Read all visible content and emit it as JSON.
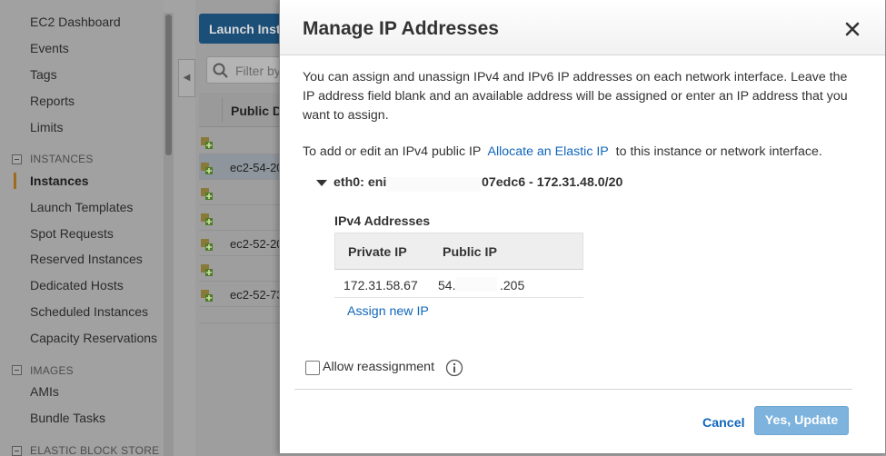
{
  "sidebar": {
    "items": [
      {
        "label": "EC2 Dashboard"
      },
      {
        "label": "Events"
      },
      {
        "label": "Tags"
      },
      {
        "label": "Reports"
      },
      {
        "label": "Limits"
      }
    ],
    "instances_section": "INSTANCES",
    "instances_items": [
      {
        "label": "Instances",
        "active": true
      },
      {
        "label": "Launch Templates"
      },
      {
        "label": "Spot Requests"
      },
      {
        "label": "Reserved Instances"
      },
      {
        "label": "Dedicated Hosts"
      },
      {
        "label": "Scheduled Instances"
      },
      {
        "label": "Capacity Reservations"
      }
    ],
    "images_section": "IMAGES",
    "images_items": [
      {
        "label": "AMIs"
      },
      {
        "label": "Bundle Tasks"
      }
    ],
    "ebs_section": "ELASTIC BLOCK STORE"
  },
  "content": {
    "launch_label": "Launch Insta",
    "filter_placeholder": "Filter by",
    "column_header": "Public D",
    "rows": [
      "",
      "ec2-54-20",
      "",
      "",
      "ec2-52-20",
      "",
      "ec2-52-73"
    ]
  },
  "modal": {
    "title": "Manage IP Addresses",
    "intro": "You can assign and unassign IPv4 and IPv6 IP addresses on each network interface. Leave the IP address field blank and an available address will be assigned or enter an IP address that you want to assign.",
    "add_prefix": "To add or edit an IPv4 public IP",
    "allocate_link": "Allocate an Elastic IP",
    "add_suffix": "to this instance or network interface.",
    "eth_label": "eth0: eni",
    "eth_suffix": "07edc6 - 172.31.48.0/20",
    "ipv4_heading": "IPv4 Addresses",
    "table": {
      "headers": [
        "Private IP",
        "Public IP"
      ],
      "private_ip": "172.31.58.67",
      "public_ip_prefix": "54.",
      "public_ip_suffix": ".205"
    },
    "assign_link": "Assign new IP",
    "allow_reassignment": "Allow reassignment",
    "cancel_label": "Cancel",
    "update_label": "Yes, Update"
  },
  "colors": {
    "accent": "#1166bb",
    "primary_button": "#7db3dd",
    "overlay": "#a3a3a3"
  }
}
